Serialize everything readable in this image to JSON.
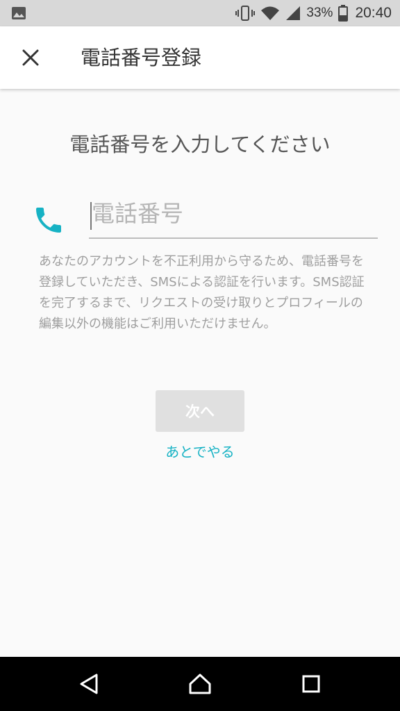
{
  "status_bar": {
    "battery_percent": "33%",
    "time": "20:40",
    "icons": [
      "image-notification-icon",
      "vibrate-icon",
      "wifi-icon",
      "cellular-signal-icon",
      "battery-icon"
    ]
  },
  "app_bar": {
    "title": "電話番号登録",
    "close_icon": "close-icon"
  },
  "form": {
    "headline": "電話番号を入力してください",
    "phone_placeholder": "電話番号",
    "phone_value": "",
    "description": "あなたのアカウントを不正利用から守るため、電話番号を登録していただき、SMSによる認証を行います。SMS認証を完了するまで、リクエストの受け取りとプロフィールの編集以外の機能はご利用いただけません。",
    "next_label": "次へ",
    "later_label": "あとでやる"
  },
  "colors": {
    "accent": "#16b2c4",
    "button_disabled_bg": "#e0e0e0",
    "text_secondary": "#9e9e9e"
  },
  "nav_bar": {
    "icons": [
      "back-icon",
      "home-icon",
      "recents-icon"
    ]
  }
}
